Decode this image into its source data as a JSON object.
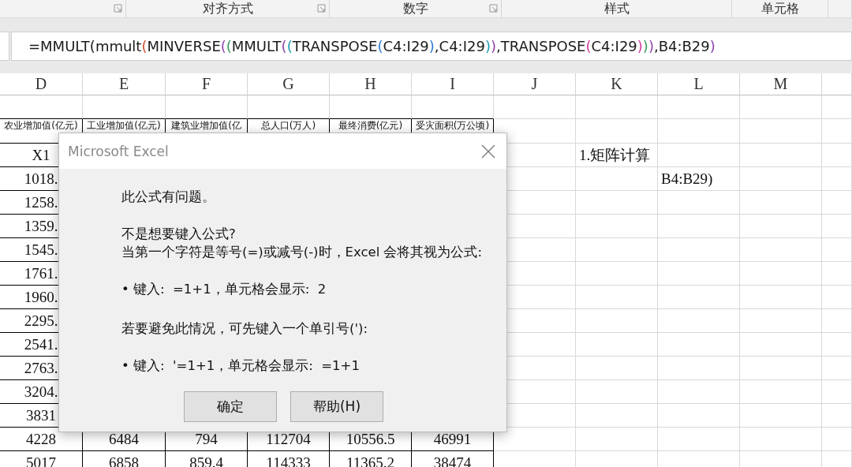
{
  "ribbon": {
    "groups": [
      {
        "launcher": true
      },
      {
        "label": "对齐方式",
        "launcher": true
      },
      {
        "label": "数字",
        "launcher": true
      },
      {
        "label": "样式",
        "launcher": false
      },
      {
        "label": "单元格",
        "launcher": false
      },
      {
        "launcher": false
      }
    ]
  },
  "formula_bar": {
    "segments": [
      {
        "text": "=MMULT(mmult",
        "color": "#1a1a1a"
      },
      {
        "text": "(",
        "color": "#d0502e"
      },
      {
        "text": "MINVERSE",
        "color": "#1a1a1a"
      },
      {
        "text": "(",
        "color": "#8e44ad"
      },
      {
        "text": "(",
        "color": "#3a9a5a"
      },
      {
        "text": "MMULT",
        "color": "#1a1a1a"
      },
      {
        "text": "(",
        "color": "#8e44ad"
      },
      {
        "text": "(",
        "color": "#1f9bb0"
      },
      {
        "text": "TRANSPOSE",
        "color": "#1a1a1a"
      },
      {
        "text": "(",
        "color": "#2b7bd4"
      },
      {
        "text": "C4:I29",
        "color": "#1a1a1a"
      },
      {
        "text": ")",
        "color": "#2b7bd4"
      },
      {
        "text": ",C4:I29",
        "color": "#1a1a1a"
      },
      {
        "text": ")",
        "color": "#1f9bb0"
      },
      {
        "text": ")",
        "color": "#8e44ad"
      },
      {
        "text": ",TRANSPOSE",
        "color": "#1a1a1a"
      },
      {
        "text": "(",
        "color": "#d63ca0"
      },
      {
        "text": "C4:I29",
        "color": "#1a1a1a"
      },
      {
        "text": ")",
        "color": "#d63ca0"
      },
      {
        "text": ")",
        "color": "#3a9a5a"
      },
      {
        "text": ")",
        "color": "#8e44ad"
      },
      {
        "text": ",B4:B29",
        "color": "#1a1a1a"
      },
      {
        "text": ")",
        "color": "#8e44ad"
      }
    ]
  },
  "sheet": {
    "columns": [
      {
        "letter": "D",
        "boxed": true
      },
      {
        "letter": "E",
        "boxed": true
      },
      {
        "letter": "F",
        "boxed": true
      },
      {
        "letter": "G",
        "boxed": true
      },
      {
        "letter": "H",
        "boxed": true
      },
      {
        "letter": "I",
        "boxed": true
      },
      {
        "letter": "J",
        "boxed": false
      },
      {
        "letter": "K",
        "boxed": false
      },
      {
        "letter": "L",
        "boxed": false
      },
      {
        "letter": "M",
        "boxed": false
      },
      {
        "boxed": false
      }
    ],
    "rows": [
      {
        "kind": "plain",
        "cells": []
      },
      {
        "kind": "heading",
        "cells": [
          "农业增加值(亿元)",
          "工业增加值(亿元)",
          "建筑业增加值(亿",
          "总人口(万人)",
          "最终消费(亿元)",
          "受灾面积(万公顷)"
        ]
      },
      {
        "kind": "plain",
        "cells": [
          "X1",
          null,
          null,
          null,
          null,
          null,
          null,
          "1.矩阵计算"
        ]
      },
      {
        "kind": "plain",
        "cells": [
          "1018.",
          null,
          null,
          null,
          null,
          null,
          null,
          null,
          "B4:B29)"
        ]
      },
      {
        "kind": "plain",
        "cells": [
          "1258."
        ]
      },
      {
        "kind": "plain",
        "cells": [
          "1359."
        ]
      },
      {
        "kind": "plain",
        "cells": [
          "1545."
        ]
      },
      {
        "kind": "plain",
        "cells": [
          "1761."
        ]
      },
      {
        "kind": "plain",
        "cells": [
          "1960."
        ]
      },
      {
        "kind": "plain",
        "cells": [
          "2295."
        ]
      },
      {
        "kind": "plain",
        "cells": [
          "2541."
        ]
      },
      {
        "kind": "plain",
        "cells": [
          "2763."
        ]
      },
      {
        "kind": "plain",
        "cells": [
          "3204."
        ]
      },
      {
        "kind": "plain",
        "cells": [
          "3831"
        ]
      },
      {
        "kind": "plain",
        "cells": [
          "4228",
          "6484",
          "794",
          "112704",
          "10556.5",
          "46991"
        ]
      },
      {
        "kind": "plain",
        "cells": [
          "5017",
          "6858",
          "859.4",
          "114333",
          "11365.2",
          "38474"
        ]
      }
    ]
  },
  "dialog": {
    "title": "Microsoft Excel",
    "paragraphs": [
      [
        "此公式有问题。"
      ],
      [
        "不是想要键入公式?",
        "当第一个字符是等号(=)或减号(-)时，Excel 会将其视为公式:"
      ],
      [
        "• 键入:  =1+1，单元格会显示:  2"
      ],
      [
        "若要避免此情况，可先键入一个单引号('):"
      ],
      [
        "• 键入:  '=1+1，单元格会显示:  =1+1"
      ]
    ],
    "buttons": [
      {
        "label": "确定"
      },
      {
        "label": "帮助(H)"
      }
    ]
  }
}
